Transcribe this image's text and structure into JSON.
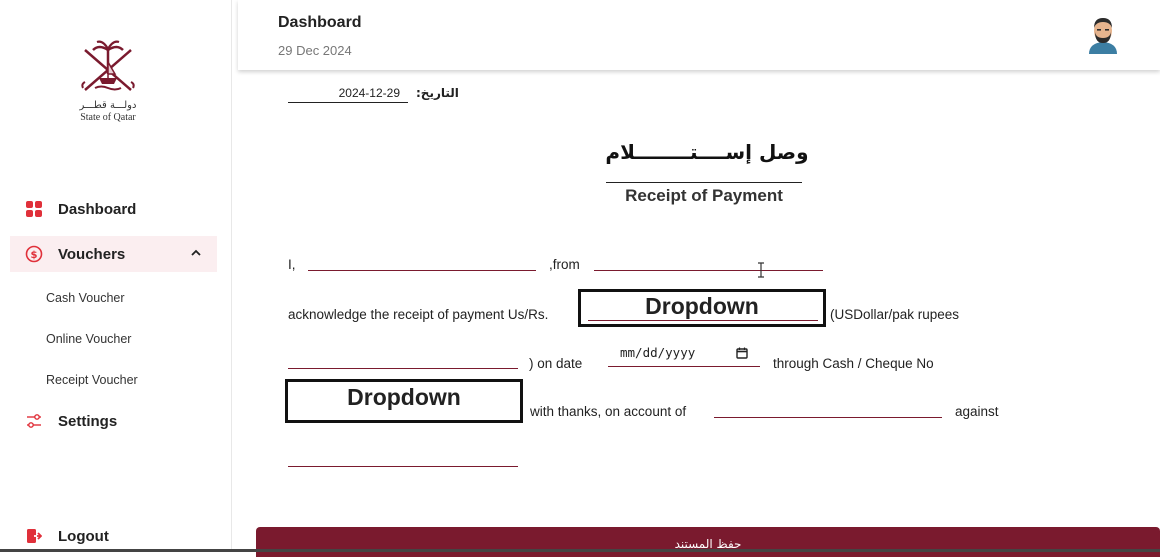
{
  "brand": {
    "arabic_name": "دولـــة قطـــر",
    "english_name": "State of Qatar"
  },
  "sidebar": {
    "items": [
      {
        "label": "Dashboard",
        "icon": "grid-icon"
      },
      {
        "label": "Vouchers",
        "icon": "dollar-circle-icon",
        "active": true,
        "expanded": true
      },
      {
        "label": "Settings",
        "icon": "sliders-icon"
      },
      {
        "label": "Logout",
        "icon": "logout-icon"
      }
    ],
    "sub_items": [
      "Cash Voucher",
      "Online Voucher",
      "Receipt Voucher"
    ]
  },
  "header": {
    "title": "Dashboard",
    "date": "29 Dec 2024"
  },
  "form": {
    "date_label": "التاريخ:",
    "date_value": "2024-12-29",
    "arabic_title": "وصل إســــتــــــــلام",
    "english_title": "Receipt of Payment",
    "line1_prefix": "I,",
    "line1_from": ",from",
    "line2_text": "acknowledge the receipt of payment Us/Rs.",
    "amount_dropdown": "Dropdown",
    "line2_suffix": "(USDollar/pak rupees",
    "line3_on_date": ")  on date",
    "date_placeholder": "mm/dd/yyyy",
    "line3_through": "through Cash / Cheque No",
    "cheque_dropdown": "Dropdown",
    "line4_thanks": "with thanks, on account of",
    "line4_against": "against",
    "save_label": "حفظ المستند"
  },
  "colors": {
    "brand_maroon": "#7a1a2e",
    "active_bg": "#fbeef0",
    "icon_red": "#e0303a"
  }
}
